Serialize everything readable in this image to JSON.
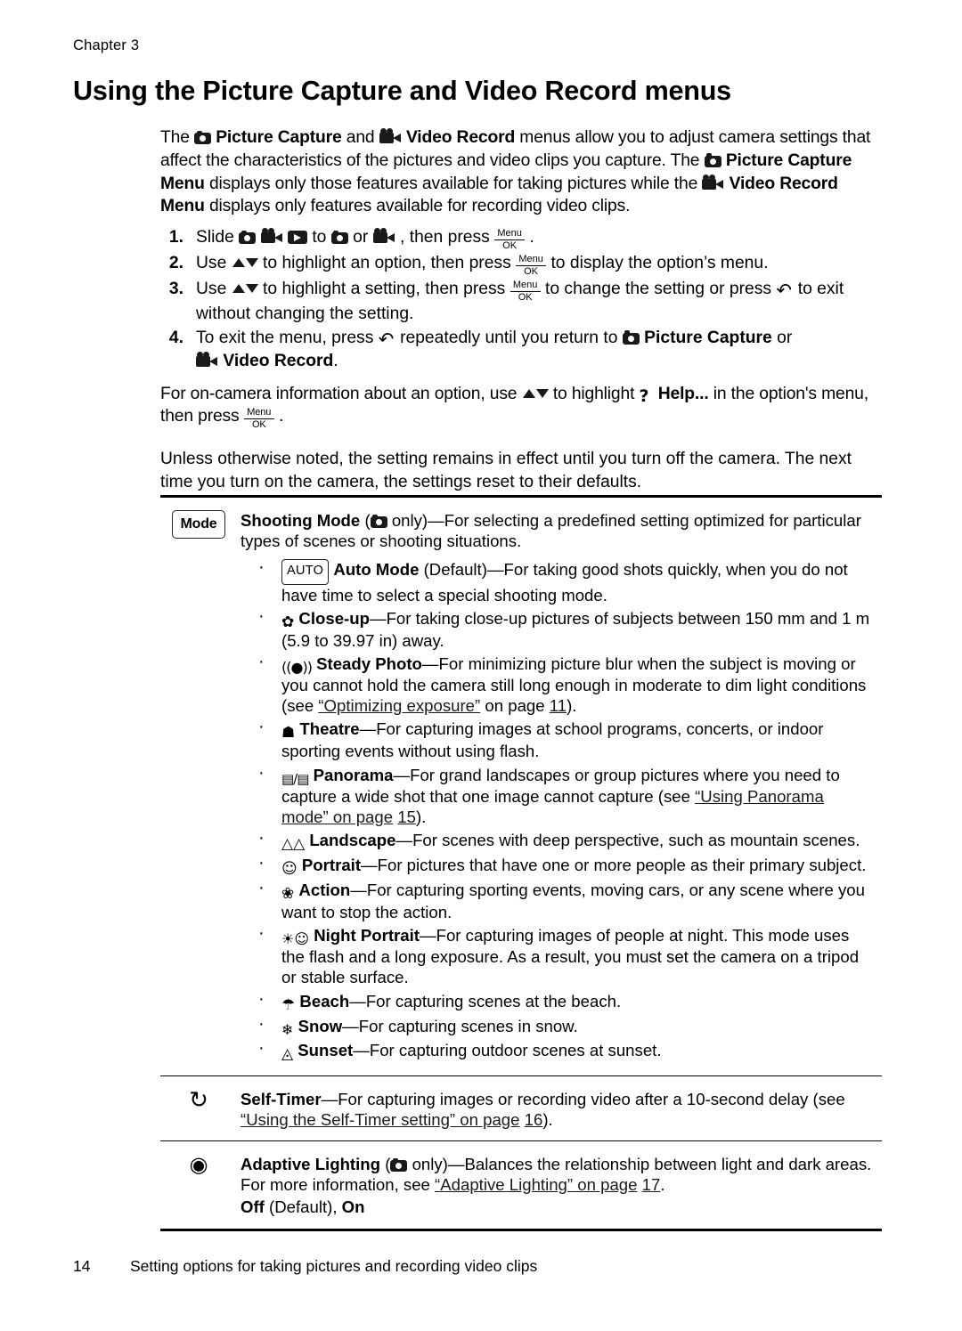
{
  "header": {
    "chapter": "Chapter  3",
    "title": "Using the Picture Capture and Video Record menus"
  },
  "intro": {
    "line1_a": "The",
    "line1_b": "Picture Capture",
    "line1_c": "and",
    "line1_d": "Video Record",
    "line1_e": "menus allow you to adjust camera settings that affect the characteristics of the pictures and video clips you capture. The",
    "line2_b": "Picture Capture Menu",
    "line2_c": "displays only those features available for taking pictures while the",
    "line2_d": "Video Record Menu",
    "line2_e": "displays only features available for recording video clips."
  },
  "steps": [
    {
      "num": "1.",
      "t1": "Slide",
      "t2": "to",
      "t3": "or",
      "t4": ", then press",
      "t5": "."
    },
    {
      "num": "2.",
      "t1": "Use",
      "t2": "to highlight an option, then press",
      "t3": "to display the option’s menu."
    },
    {
      "num": "3.",
      "t1": "Use",
      "t2": "to highlight a setting, then press",
      "t3": "to change the setting or press",
      "t4": "to exit without changing the setting."
    },
    {
      "num": "4.",
      "t1": "To exit the menu, press",
      "t2": "repeatedly until you return to",
      "t3": "Picture Capture",
      "t4": "or",
      "t5": "Video Record",
      "t6": "."
    }
  ],
  "help_para": {
    "a": "For on-camera information about an option, use",
    "b": "to highlight",
    "c": "Help...",
    "d": "in the option's menu, then press",
    "e": "."
  },
  "note_para": "Unless otherwise noted, the setting remains in effect until you turn off the camera. The next time you turn on the camera, the settings reset to their defaults.",
  "table": {
    "rows": [
      {
        "icon_label": "Mode",
        "title": "Shooting Mode",
        "title_rest_a": "(",
        "title_rest_b": "only)—For selecting a predefined setting optimized for particular types of scenes or shooting situations.",
        "bullets": [
          {
            "badge": "AUTO",
            "name": "Auto Mode",
            "text": "(Default)—For taking good shots quickly, when you do not have time to select a special shooting mode."
          },
          {
            "icon": "closeup-icon",
            "name": "Close-up",
            "text": "—For taking close-up pictures of subjects between 150 mm and 1 m (5.9 to 39.97 in) away."
          },
          {
            "icon": "steady-photo-icon",
            "name": "Steady Photo",
            "text": "—For minimizing picture blur when the subject is moving or you cannot hold the camera still long enough in moderate to dim light conditions (see ",
            "link": "“Optimizing exposure”",
            "text2": " on page",
            "page": "11",
            "text3": ")."
          },
          {
            "icon": "theatre-icon",
            "name": "Theatre",
            "text": "—For capturing images at school programs, concerts, or indoor sporting events without using flash."
          },
          {
            "icon": "panorama-icon",
            "name": "Panorama",
            "text": "—For grand landscapes or group pictures where you need to capture a wide shot that one image cannot capture (see ",
            "link": "“Using Panorama mode” on page",
            "page": "15",
            "text3": ")."
          },
          {
            "icon": "landscape-icon",
            "name": "Landscape",
            "text": "—For scenes with deep perspective, such as mountain scenes."
          },
          {
            "icon": "portrait-icon",
            "name": "Portrait",
            "text": "—For pictures that have one or more people as their primary subject."
          },
          {
            "icon": "action-icon",
            "name": "Action",
            "text": "—For capturing sporting events, moving cars, or any scene where you want to stop the action."
          },
          {
            "icon": "night-portrait-icon",
            "name": "Night Portrait",
            "text": "—For capturing images of people at night. This mode uses the flash and a long exposure. As a result, you must set the camera on a tripod or stable surface."
          },
          {
            "icon": "beach-icon",
            "name": "Beach",
            "text": "—For capturing scenes at the beach."
          },
          {
            "icon": "snow-icon",
            "name": "Snow",
            "text": "—For capturing scenes in snow."
          },
          {
            "icon": "sunset-icon",
            "name": "Sunset",
            "text": "—For capturing outdoor scenes at sunset."
          }
        ]
      },
      {
        "icon_name": "self-timer-icon",
        "title": "Self-Timer",
        "text": "—For capturing images or recording video after a 10-second delay (see ",
        "link": "“Using the Self-Timer setting” on page",
        "page": "16",
        "text2": ")."
      },
      {
        "icon_name": "adaptive-lighting-icon",
        "title": "Adaptive Lighting",
        "text_a": "(",
        "text_b": "only)—Balances the relationship between light and dark areas. For more information, see ",
        "link": "“Adaptive Lighting” on page",
        "page": "17",
        "text2": ".",
        "options_off": "Off",
        "options_default": "(Default),",
        "options_on": "On"
      }
    ]
  },
  "footer": {
    "page_number": "14",
    "text": "Setting options for taking pictures and recording video clips"
  }
}
